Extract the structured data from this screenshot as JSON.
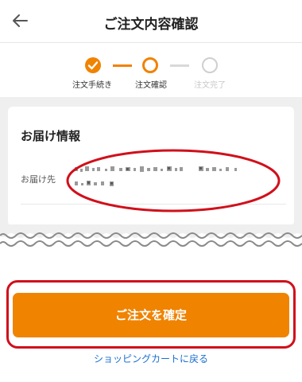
{
  "header": {
    "title": "ご注文内容確認",
    "back_icon": "arrow-left-icon"
  },
  "stepper": {
    "accent_color": "#f08300",
    "steps": [
      {
        "label": "注文手続き",
        "state": "done"
      },
      {
        "label": "注文確認",
        "state": "current"
      },
      {
        "label": "注文完了",
        "state": "todo"
      }
    ]
  },
  "delivery": {
    "title": "お届け情報",
    "address_label": "お届け先"
  },
  "actions": {
    "confirm_label": "ご注文を確定",
    "cart_link": "ショッピングカートに戻る"
  },
  "colors": {
    "accent": "#f08300",
    "link": "#1a6fd0",
    "annotation": "#d0101b"
  }
}
